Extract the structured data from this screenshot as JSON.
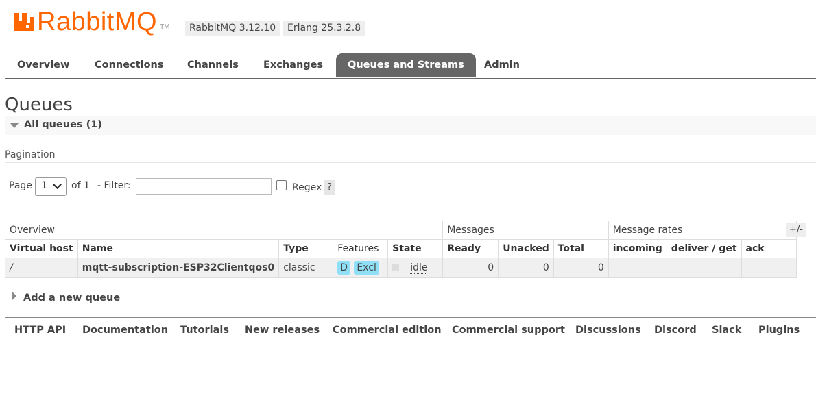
{
  "header": {
    "logo_text": "RabbitMQ",
    "logo_tm": "TM",
    "rabbitmq_version": "RabbitMQ 3.12.10",
    "erlang_version": "Erlang 25.3.2.8",
    "brand_color": "#ff6600"
  },
  "tabs": [
    {
      "label": "Overview",
      "active": false
    },
    {
      "label": "Connections",
      "active": false
    },
    {
      "label": "Channels",
      "active": false
    },
    {
      "label": "Exchanges",
      "active": false
    },
    {
      "label": "Queues and Streams",
      "active": true
    },
    {
      "label": "Admin",
      "active": false
    }
  ],
  "page": {
    "title": "Queues",
    "section_label": "All queues (1)",
    "pagination_label": "Pagination",
    "page_label": "Page",
    "page_value": "1",
    "of_label": "of 1",
    "filter_label": "- Filter:",
    "filter_value": "",
    "regex_label": "Regex",
    "help_label": "?"
  },
  "table": {
    "groups": {
      "overview": "Overview",
      "messages": "Messages",
      "rates": "Message rates",
      "toggle": "+/-"
    },
    "columns": {
      "vhost": "Virtual host",
      "name": "Name",
      "type": "Type",
      "features": "Features",
      "state": "State",
      "ready": "Ready",
      "unacked": "Unacked",
      "total": "Total",
      "incoming": "incoming",
      "deliver_get": "deliver / get",
      "ack": "ack"
    },
    "rows": [
      {
        "vhost": "/",
        "name": "mqtt-subscription-ESP32Clientqos0",
        "type": "classic",
        "feature_d": "D",
        "feature_excl": "Excl",
        "state": "idle",
        "ready": "0",
        "unacked": "0",
        "total": "0",
        "incoming": "",
        "deliver_get": "",
        "ack": ""
      }
    ]
  },
  "add_queue_label": "Add a new queue",
  "footer": {
    "links": [
      "HTTP API",
      "Documentation",
      "Tutorials",
      "New releases",
      "Commercial edition",
      "Commercial support",
      "Discussions",
      "Discord",
      "Slack",
      "Plugins"
    ]
  }
}
